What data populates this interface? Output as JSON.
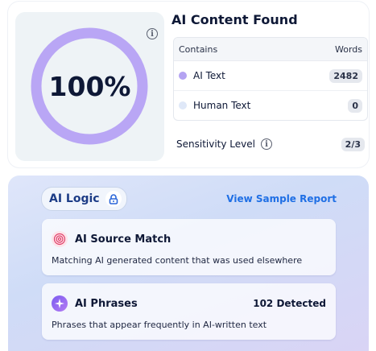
{
  "score": {
    "percentage_text": "100%",
    "ring_color": "#b9a6f5",
    "info_icon": "info-icon"
  },
  "results": {
    "title": "AI Content Found",
    "table": {
      "col_contains": "Contains",
      "col_words": "Words",
      "rows": [
        {
          "label": "AI Text",
          "count": "2482",
          "dot_color": "#b4a3f2"
        },
        {
          "label": "Human Text",
          "count": "0",
          "dot_color": "#dfe8f8"
        }
      ]
    },
    "sensitivity": {
      "label": "Sensitivity Level",
      "value": "2/3"
    }
  },
  "ai_logic": {
    "chip_label": "AI Logic",
    "lock_icon": "lock-icon",
    "sample_link": "View Sample Report",
    "features": [
      {
        "title": "AI Source Match",
        "count": "",
        "description": "Matching AI generated content that was used elsewhere",
        "icon": "fingerprint-icon"
      },
      {
        "title": "AI Phrases",
        "count": "102 Detected",
        "description": "Phrases that appear frequently in AI-written text",
        "icon": "sparkle-icon"
      }
    ]
  }
}
